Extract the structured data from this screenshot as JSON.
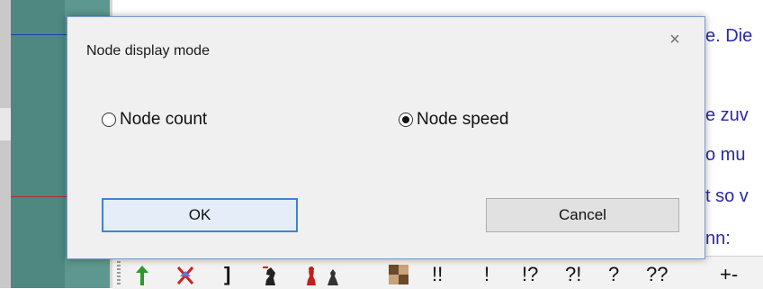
{
  "dialog": {
    "title": "Node display mode",
    "close_glyph": "×",
    "options": [
      {
        "label": "Node count",
        "checked": false
      },
      {
        "label": "Node speed",
        "checked": true
      }
    ],
    "ok_label": "OK",
    "cancel_label": "Cancel"
  },
  "background_doc": {
    "lines": [
      "e. Die",
      "e zuv",
      "o mu",
      "t so v",
      "nn:"
    ]
  },
  "toolbar": {
    "icons": [
      "green-arrow-icon",
      "red-x-icon",
      "knight-piece-icon",
      "rook-piece-icon",
      "pawn-piece-icon",
      "board-icon"
    ],
    "annotations": [
      "!!",
      "!",
      "!?",
      "?!",
      "?",
      "??",
      "+-"
    ],
    "bracket": "]"
  },
  "colors": {
    "accent": "#3c84d4",
    "doc_text": "#2a2aa6",
    "board": "#4e8880"
  }
}
